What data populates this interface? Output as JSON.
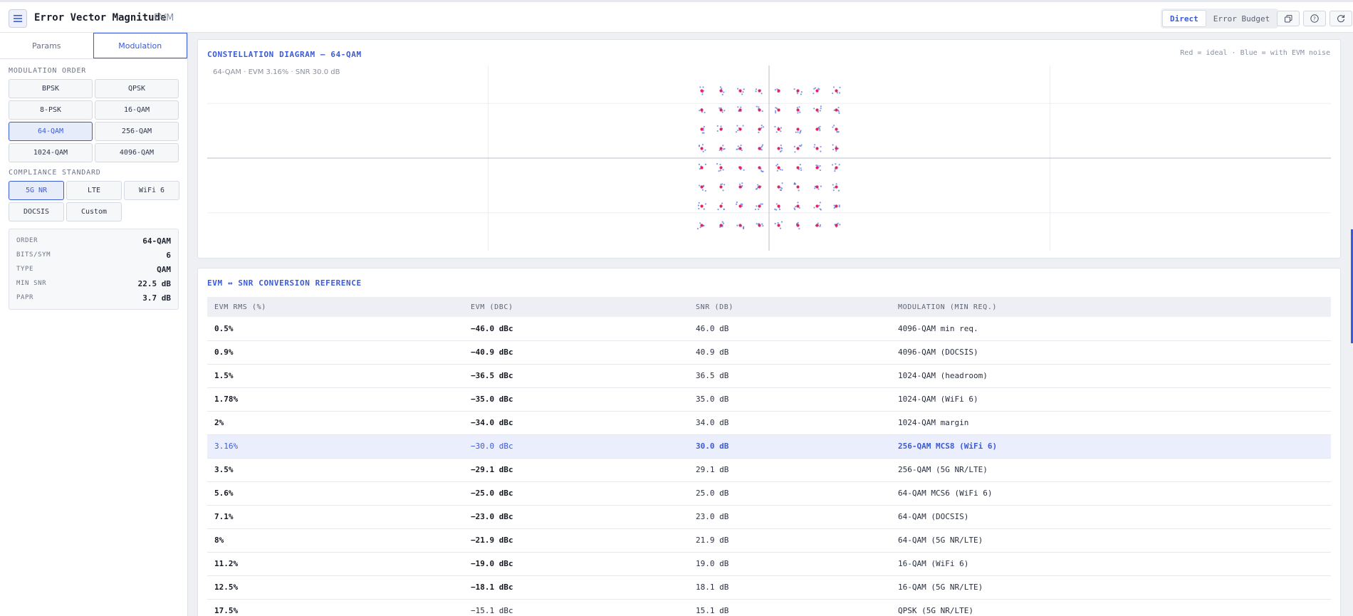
{
  "header": {
    "title": "Error Vector Magnitude",
    "subtitle": "EVM",
    "modes": [
      "Direct",
      "Error Budget"
    ],
    "active_mode": "Direct"
  },
  "sidebar": {
    "tabs": [
      "Params",
      "Modulation"
    ],
    "active_tab": "Modulation",
    "modulation_label": "MODULATION ORDER",
    "modulations": [
      "BPSK",
      "QPSK",
      "8-PSK",
      "16-QAM",
      "64-QAM",
      "256-QAM",
      "1024-QAM",
      "4096-QAM"
    ],
    "selected_modulation": "64-QAM",
    "compliance_label": "COMPLIANCE STANDARD",
    "standards": [
      "5G NR",
      "LTE",
      "WiFi 6",
      "DOCSIS",
      "Custom"
    ],
    "selected_standard": "5G NR",
    "info": [
      {
        "key": "ORDER",
        "value": "64-QAM"
      },
      {
        "key": "BITS/SYM",
        "value": "6"
      },
      {
        "key": "TYPE",
        "value": "QAM"
      },
      {
        "key": "MIN SNR",
        "value": "22.5 dB"
      },
      {
        "key": "PAPR",
        "value": "3.7 dB"
      }
    ]
  },
  "constellation": {
    "title": "CONSTELLATION DIAGRAM — 64-QAM",
    "legend_note": "Red = ideal · Blue = with EVM noise",
    "caption": "64-QAM · EVM 3.16% · SNR 30.0 dB",
    "colors": {
      "ideal": "#e0245e",
      "noisy": "#5b74e0"
    }
  },
  "chart_data": {
    "type": "scatter",
    "title": "CONSTELLATION DIAGRAM — 64-QAM",
    "modulation": "64-QAM",
    "evm_percent": 3.16,
    "snr_db": 30.0,
    "ideal_levels": [
      -7,
      -5,
      -3,
      -1,
      1,
      3,
      5,
      7
    ],
    "points_per_symbol": 5,
    "series": [
      {
        "name": "ideal",
        "points": "8x8 grid at levels ±1, ±3, ±5, ±7"
      },
      {
        "name": "with EVM noise",
        "points": "scattered around each ideal point"
      }
    ]
  },
  "table": {
    "title": "EVM ↔ SNR CONVERSION REFERENCE",
    "columns": [
      "EVM RMS (%)",
      "EVM (DBC)",
      "SNR (DB)",
      "MODULATION (MIN REQ.)"
    ],
    "rows": [
      [
        "0.5%",
        "−46.0 dBc",
        "46.0 dB",
        "4096-QAM min req."
      ],
      [
        "0.9%",
        "−40.9 dBc",
        "40.9 dB",
        "4096-QAM (DOCSIS)"
      ],
      [
        "1.5%",
        "−36.5 dBc",
        "36.5 dB",
        "1024-QAM (headroom)"
      ],
      [
        "1.78%",
        "−35.0 dBc",
        "35.0 dB",
        "1024-QAM (WiFi 6)"
      ],
      [
        "2%",
        "−34.0 dBc",
        "34.0 dB",
        "1024-QAM margin"
      ],
      [
        "3.16%",
        "−30.0 dBc",
        "30.0 dB",
        "256-QAM MCS8 (WiFi 6)"
      ],
      [
        "3.5%",
        "−29.1 dBc",
        "29.1 dB",
        "256-QAM (5G NR/LTE)"
      ],
      [
        "5.6%",
        "−25.0 dBc",
        "25.0 dB",
        "64-QAM MCS6 (WiFi 6)"
      ],
      [
        "7.1%",
        "−23.0 dBc",
        "23.0 dB",
        "64-QAM (DOCSIS)"
      ],
      [
        "8%",
        "−21.9 dBc",
        "21.9 dB",
        "64-QAM (5G NR/LTE)"
      ],
      [
        "11.2%",
        "−19.0 dBc",
        "19.0 dB",
        "16-QAM (WiFi 6)"
      ],
      [
        "12.5%",
        "−18.1 dBc",
        "18.1 dB",
        "16-QAM (5G NR/LTE)"
      ],
      [
        "17.5%",
        "−15.1 dBc",
        "15.1 dB",
        "QPSK (5G NR/LTE)"
      ]
    ],
    "highlight_row": 5
  }
}
